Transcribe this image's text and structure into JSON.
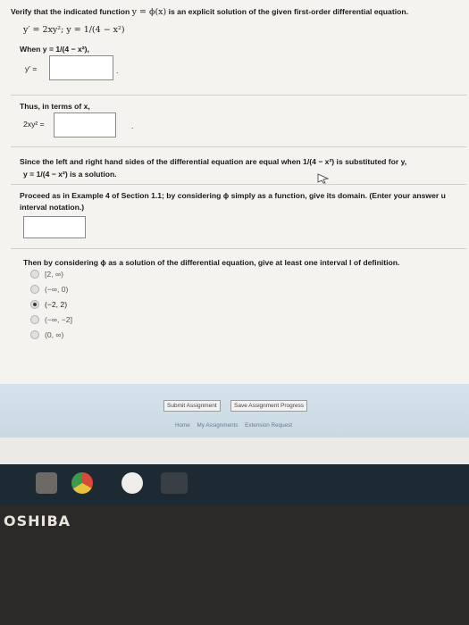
{
  "question": {
    "intro_prefix": "Verify that the indicated function ",
    "intro_math": "y = ϕ(x)",
    "intro_suffix": " is an explicit solution of the given first-order differential equation.",
    "ode": "y′ = 2xy²;    y = 1/(4 − x²)",
    "when_label": "When  y = 1/(4 − x²),",
    "yprime_label": "y′ =",
    "yprime_value": "",
    "yprime_dot": ".",
    "thus_label": "Thus, in terms of x,",
    "twoxy_label": "2xy² =",
    "twoxy_value": "",
    "twoxy_dot": ".",
    "since_line1": "Since the left and right hand sides of the differential equation are equal when  1/(4 − x²)  is substituted for y,",
    "since_line2": "y = 1/(4 − x²)  is a solution.",
    "proceed_line1": "Proceed as in Example 4 of Section 1.1; by considering ϕ simply as a function, give its domain. (Enter your answer u",
    "proceed_line2": "interval notation.)",
    "domain_value": "",
    "interval_prompt": "Then by considering ϕ as a solution of the differential equation, give at least one interval I of definition.",
    "options": [
      {
        "label": "[2, ∞)",
        "checked": false
      },
      {
        "label": "(−∞, 0)",
        "checked": false
      },
      {
        "label": "(−2, 2)",
        "checked": true
      },
      {
        "label": "(−∞, −2]",
        "checked": false
      },
      {
        "label": "(0, ∞)",
        "checked": false
      }
    ]
  },
  "footer": {
    "submit_label": "Submit Assignment",
    "save_label": "Save Assignment Progress",
    "links": [
      "Home",
      "My Assignments",
      "Extension Request"
    ]
  },
  "device": {
    "brand": "OSHIBA"
  },
  "colors": {
    "page_bg": "#f4f3f0",
    "footer_bg": "#c9d8e2",
    "taskbar_bg": "#1e2a33"
  }
}
